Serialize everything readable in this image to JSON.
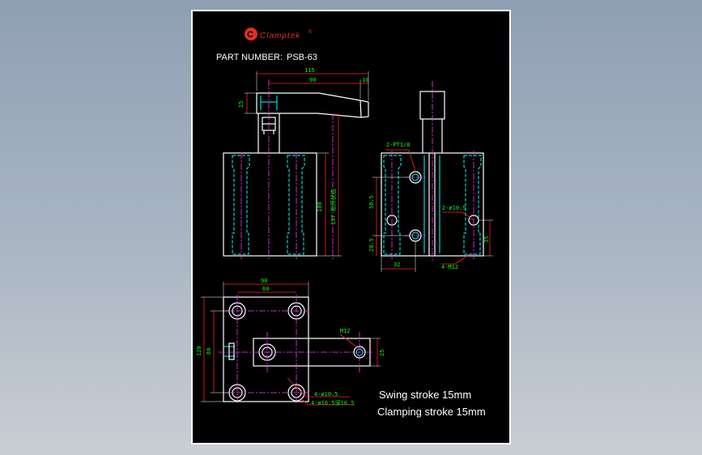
{
  "brand": {
    "logo_letter": "C",
    "name": "Clamptek",
    "reg": "®"
  },
  "part_number_label": "PART NUMBER:",
  "part_number": "PSB-63",
  "notes": {
    "swing": "Swing stroke 15mm",
    "clamping": "Clamping stroke 15mm"
  },
  "dims": {
    "front_115": "115",
    "front_90": "90",
    "front_10": "10",
    "front_25": "25",
    "front_100": "100",
    "front_137": "137 松开状态",
    "side_pt": "2-PT1/8",
    "side_565": "56.5",
    "side_205": "20.5",
    "side_32": "32",
    "side_4m12": "4-M12",
    "side_2phi": "2-ø10.5",
    "side_35": "35",
    "top_90": "90",
    "top_60": "60",
    "top_120": "120",
    "top_80": "80",
    "top_m12": "M12",
    "top_25": "25",
    "top_4phi105": "4-ø10.5",
    "top_4phi16": "4-ø16.5深10.5"
  },
  "colors": {
    "outline": "#ffffff",
    "hidden": "#00ffff",
    "center": "#ff33ff",
    "dim_line": "#ff2020",
    "dim_text": "#00ff00",
    "logo": "#e03020"
  }
}
